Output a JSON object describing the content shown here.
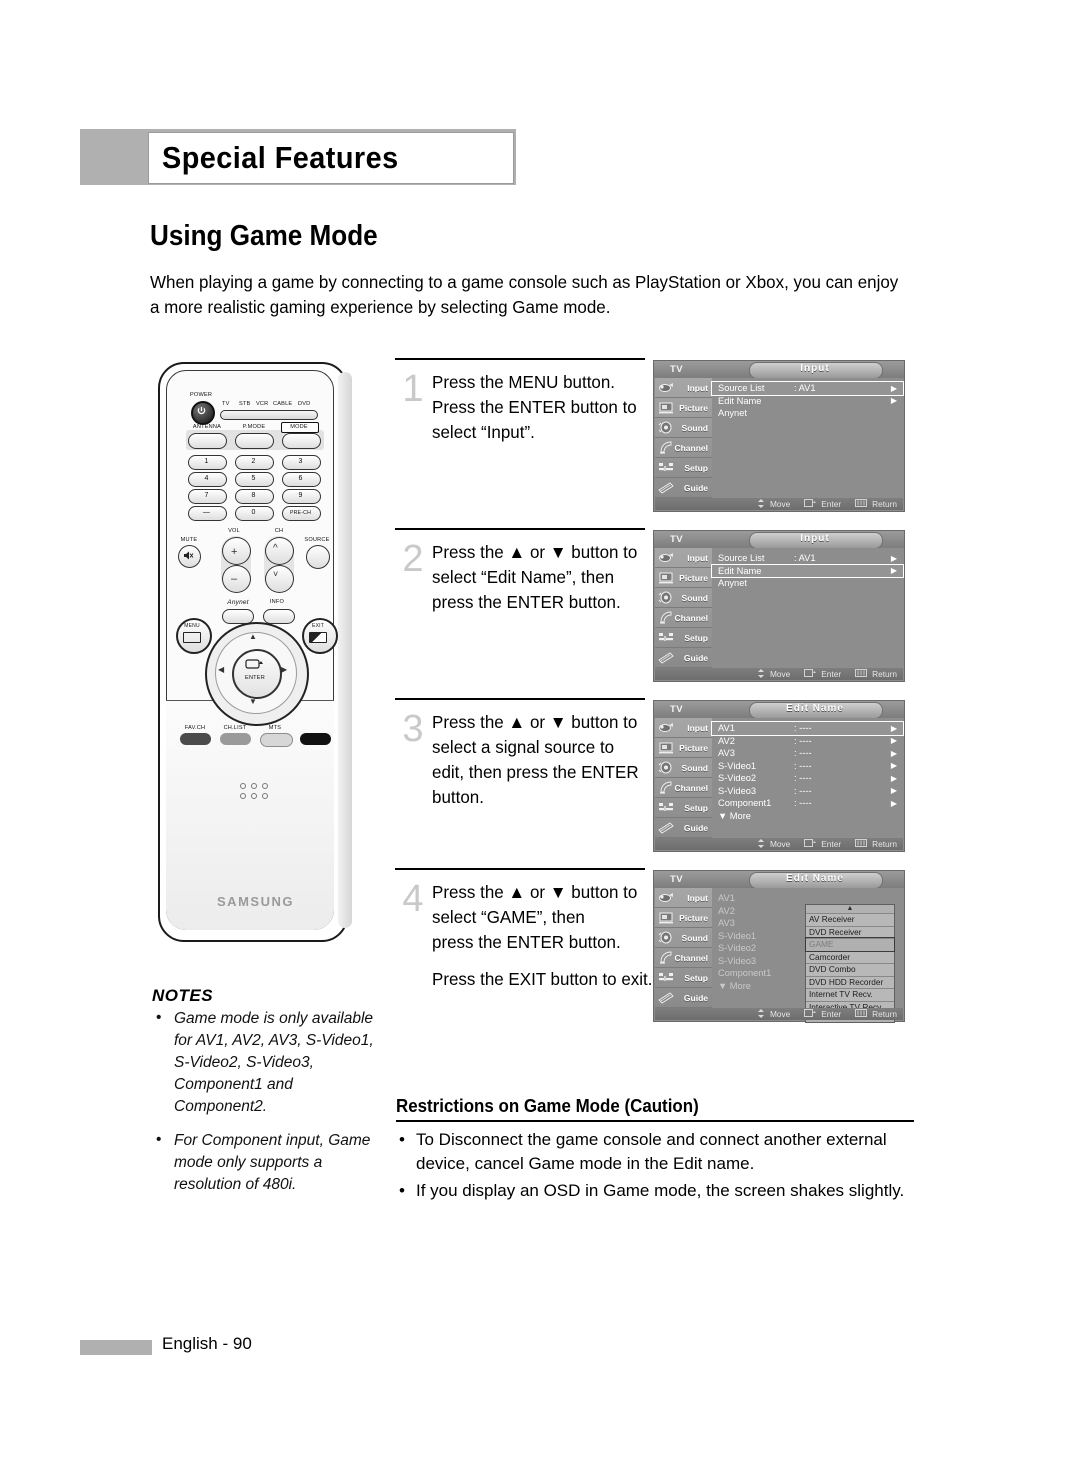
{
  "header": {
    "chapter_title": "Special Features"
  },
  "section": {
    "title": "Using Game Mode"
  },
  "intro": "When playing a game by connecting to a game console such as PlayStation or Xbox, you can enjoy a more realistic gaming experience by selecting Game mode.",
  "remote": {
    "power_label": "POWER",
    "device_labels": [
      "TV",
      "STB",
      "VCR",
      "CABLE",
      "DVD"
    ],
    "row_labels": [
      "ANTENNA",
      "P.MODE",
      "MODE"
    ],
    "keypad": [
      "1",
      "2",
      "3",
      "4",
      "5",
      "6",
      "7",
      "8",
      "9",
      "—",
      "0",
      "PRE-CH"
    ],
    "vol_label": "VOL",
    "ch_label": "CH",
    "mute_label": "MUTE",
    "source_label": "SOURCE",
    "anynet_label": "Anynet",
    "info_label": "INFO",
    "menu_label": "MENU",
    "exit_label": "EXIT",
    "enter_label": "ENTER",
    "bottom_labels": [
      "FAV.CH",
      "CH.LIST",
      "MTS"
    ],
    "brand": "SAMSUNG"
  },
  "steps": [
    {
      "number": "1",
      "text": "Press the MENU button.\nPress the ENTER button to\nselect “Input”."
    },
    {
      "number": "2",
      "text": "Press the ▲ or ▼ button to\nselect “Edit Name”, then\npress the ENTER button."
    },
    {
      "number": "3",
      "text": "Press the ▲ or ▼ button to\nselect a signal source to\nedit, then press the ENTER\nbutton."
    },
    {
      "number": "4",
      "text": "Press the ▲ or ▼ button to\nselect “GAME”, then\npress the ENTER button.\n\nPress the EXIT button to exit."
    }
  ],
  "osd_common": {
    "tv_label": "TV",
    "sidebar": [
      "Input",
      "Picture",
      "Sound",
      "Channel",
      "Setup",
      "Guide"
    ],
    "sidebar_icons": [
      "input-icon",
      "picture-icon",
      "sound-icon",
      "channel-icon",
      "setup-icon",
      "guide-icon"
    ],
    "footer": [
      {
        "icon": "move-icon",
        "label": "Move"
      },
      {
        "icon": "enter-icon",
        "label": "Enter"
      },
      {
        "icon": "return-icon",
        "label": "Return"
      }
    ]
  },
  "osd_screens": [
    {
      "title": "Input",
      "rows": [
        {
          "label": "Source List",
          "value": ": AV1",
          "arrow": "▶",
          "selected": true
        },
        {
          "label": "Edit Name",
          "value": "",
          "arrow": "▶",
          "selected": false
        },
        {
          "label": "Anynet",
          "value": "",
          "arrow": "",
          "selected": false
        }
      ]
    },
    {
      "title": "Input",
      "rows": [
        {
          "label": "Source List",
          "value": ": AV1",
          "arrow": "▶",
          "selected": false
        },
        {
          "label": "Edit Name",
          "value": "",
          "arrow": "▶",
          "selected": true
        },
        {
          "label": "Anynet",
          "value": "",
          "arrow": "",
          "selected": false
        }
      ]
    },
    {
      "title": "Edit Name",
      "rows": [
        {
          "label": "AV1",
          "value": ": ----",
          "arrow": "▶",
          "selected": true
        },
        {
          "label": "AV2",
          "value": ": ----",
          "arrow": "▶",
          "selected": false
        },
        {
          "label": "AV3",
          "value": ": ----",
          "arrow": "▶",
          "selected": false
        },
        {
          "label": "S-Video1",
          "value": ": ----",
          "arrow": "▶",
          "selected": false
        },
        {
          "label": "S-Video2",
          "value": ": ----",
          "arrow": "▶",
          "selected": false
        },
        {
          "label": "S-Video3",
          "value": ": ----",
          "arrow": "▶",
          "selected": false
        },
        {
          "label": "Component1",
          "value": ": ----",
          "arrow": "▶",
          "selected": false
        },
        {
          "label": "▼ More",
          "value": "",
          "arrow": "",
          "selected": false
        }
      ]
    },
    {
      "title": "Edit Name",
      "rows": [
        {
          "label": "AV1",
          "value": "",
          "arrow": "",
          "selected": false,
          "dim": true
        },
        {
          "label": "AV2",
          "value": "",
          "arrow": "",
          "selected": false,
          "dim": true
        },
        {
          "label": "AV3",
          "value": "",
          "arrow": "",
          "selected": false,
          "dim": true
        },
        {
          "label": "S-Video1",
          "value": "",
          "arrow": "",
          "selected": false,
          "dim": true
        },
        {
          "label": "S-Video2",
          "value": "",
          "arrow": "",
          "selected": false,
          "dim": true
        },
        {
          "label": "S-Video3",
          "value": "",
          "arrow": "",
          "selected": false,
          "dim": true
        },
        {
          "label": "Component1",
          "value": "",
          "arrow": "",
          "selected": false,
          "dim": true
        },
        {
          "label": "▼ More",
          "value": "",
          "arrow": "",
          "selected": false,
          "dim": true
        }
      ],
      "dropdown": {
        "scroll_up": "▲",
        "scroll_down": "▼",
        "items": [
          {
            "label": "AV Receiver",
            "selected": false
          },
          {
            "label": "DVD Receiver",
            "selected": false
          },
          {
            "label": "GAME",
            "selected": true
          },
          {
            "label": "Camcorder",
            "selected": false
          },
          {
            "label": "DVD Combo",
            "selected": false
          },
          {
            "label": "DVD HDD Recorder",
            "selected": false
          },
          {
            "label": "Internet TV Recv.",
            "selected": false
          },
          {
            "label": "Interactive TV Recv.",
            "selected": false
          }
        ]
      }
    }
  ],
  "notes": {
    "title": "NOTES",
    "items": [
      "Game mode is only available for AV1, AV2, AV3, S-Video1, S-Video2, S-Video3, Component1 and Component2.",
      "For Component input, Game mode only supports a resolution of 480i."
    ]
  },
  "restrictions": {
    "title": "Restrictions on Game Mode (Caution)",
    "items": [
      "To Disconnect the game console and connect another external device, cancel Game mode in the Edit name.",
      "If you display an OSD in Game mode, the screen shakes slightly."
    ]
  },
  "footer": {
    "page_label": "English - 90"
  },
  "colors": {
    "accent_gray": "#b0b0b0",
    "osd_bg": "#8d8d8d",
    "step_num": "#c9c9c9"
  }
}
